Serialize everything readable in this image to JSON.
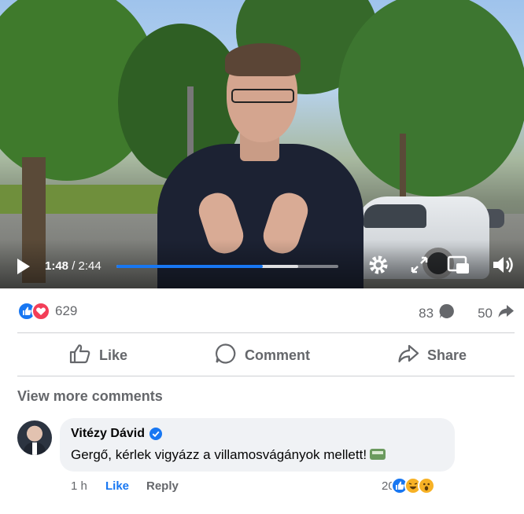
{
  "video": {
    "current_time": "1:48",
    "total_time": " / 2:44",
    "progress": 0.659,
    "buffered": 0.82
  },
  "reactions": {
    "count": "629",
    "types": [
      "like-icon",
      "love-icon"
    ]
  },
  "stats": {
    "comments": "83",
    "shares": "50"
  },
  "actions": {
    "like": "Like",
    "comment": "Comment",
    "share": "Share"
  },
  "comments": {
    "view_more": "View more comments",
    "items": [
      {
        "author": "Vitézy Dávid",
        "verified": true,
        "text": "Gergő, kérlek vigyázz a villamosvágányok mellett!",
        "emoji": "tram-icon",
        "time": "1 h",
        "like_label": "Like",
        "reply_label": "Reply",
        "reaction_count": "20",
        "reactions": [
          "like-icon",
          "haha-icon",
          "wow-icon"
        ]
      }
    ]
  },
  "colors": {
    "accent": "#1877f2",
    "love": "#f33e58",
    "muted_text": "#65676b",
    "bubble": "#f0f2f5"
  }
}
